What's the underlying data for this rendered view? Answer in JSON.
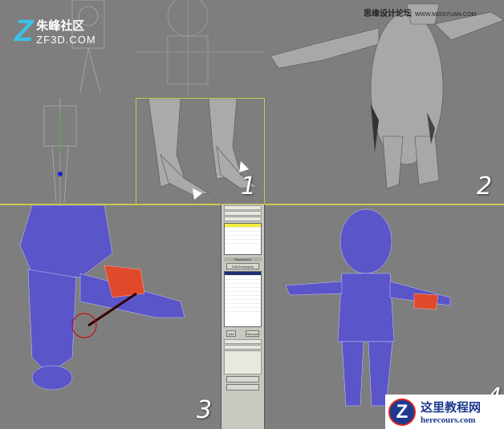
{
  "logo_top": {
    "name": "朱峰社区",
    "url": "ZF3D.COM"
  },
  "watermark": {
    "name": "思缘设计论坛",
    "url": "WWW.MISSYUAN.COM"
  },
  "logo_bottom": {
    "name": "这里教程网",
    "url": "herecours.com"
  },
  "steps": [
    "1",
    "2",
    "3",
    "4"
  ],
  "command_panel": {
    "rollout_parameters": "Parameters",
    "edit_envelopes": "Edit Envelopes",
    "add": "Add",
    "remove": "Remove"
  },
  "colors": {
    "selection_yellow": "#f0ec40",
    "viewport_border": "#c8c850",
    "mesh_blue": "#5a55c8"
  }
}
